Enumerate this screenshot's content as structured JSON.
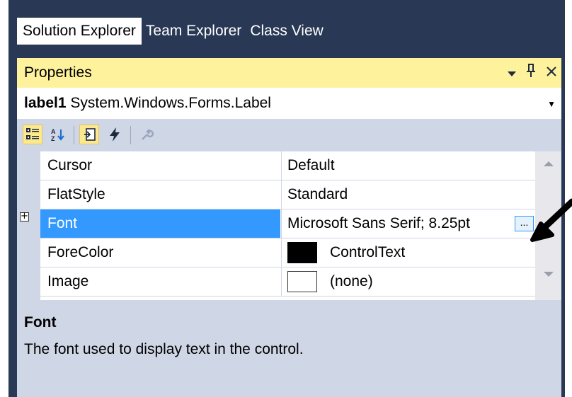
{
  "tabs": [
    {
      "label": "Solution Explorer",
      "active": true
    },
    {
      "label": "Team Explorer",
      "active": false
    },
    {
      "label": "Class View",
      "active": false
    }
  ],
  "properties": {
    "title": "Properties",
    "icons": [
      "dropdown-arrow-icon",
      "pin-icon",
      "close-icon"
    ],
    "object": {
      "name": "label1",
      "type": "System.Windows.Forms.Label"
    },
    "toolbar": [
      "categorized-icon",
      "alphabetical-icon",
      "properties-icon",
      "events-icon",
      "property-pages-icon"
    ],
    "rows": [
      {
        "name": "Cursor",
        "value": "Default"
      },
      {
        "name": "FlatStyle",
        "value": "Standard"
      },
      {
        "name": "Font",
        "value": "Microsoft Sans Serif; 8.25pt",
        "selected": true,
        "expandable": true,
        "ellipsis": "..."
      },
      {
        "name": "ForeColor",
        "value": "ControlText",
        "swatch": "#000000"
      },
      {
        "name": "Image",
        "value": "(none)",
        "swatch": "#ffffff"
      }
    ],
    "description": {
      "title": "Font",
      "text": "The font used to display text in the control."
    }
  },
  "colors": {
    "frame": "#293955",
    "title_bar": "#fff29d",
    "toolbar": "#cfd6e5",
    "selection": "#3399ff"
  }
}
